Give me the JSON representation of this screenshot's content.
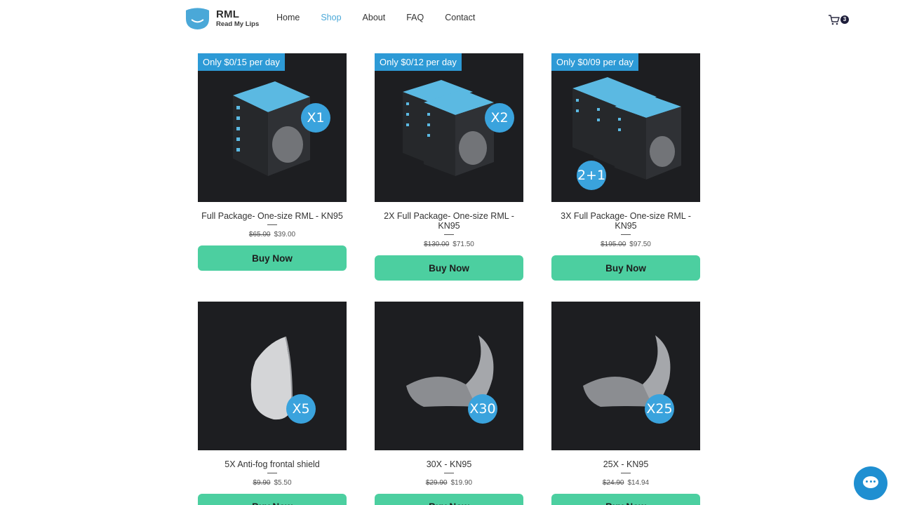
{
  "brand": {
    "title": "RML",
    "subtitle": "Read My Lips",
    "color": "#4aa8d8"
  },
  "nav": [
    {
      "label": "Home",
      "active": false
    },
    {
      "label": "Shop",
      "active": true
    },
    {
      "label": "About",
      "active": false
    },
    {
      "label": "FAQ",
      "active": false
    },
    {
      "label": "Contact",
      "active": false
    }
  ],
  "cart": {
    "icon": "cart-icon",
    "count": "3"
  },
  "products": [
    {
      "ribbon": "Only $0/15 per day",
      "badge": "X1",
      "name": "Full Package- One-size RML - KN95",
      "old_price": "$65.00",
      "price": "$39.00",
      "button": "Buy Now",
      "image": "mask-box-x1"
    },
    {
      "ribbon": "Only $0/12 per day",
      "badge": "X2",
      "name": "2X Full Package- One-size RML - KN95",
      "old_price": "$130.00",
      "price": "$71.50",
      "button": "Buy Now",
      "image": "mask-box-x2"
    },
    {
      "ribbon": "Only $0/09 per day",
      "badge": "2+1",
      "name": "3X Full Package- One-size RML - KN95",
      "old_price": "$195.00",
      "price": "$97.50",
      "button": "Buy Now",
      "image": "mask-box-x3"
    },
    {
      "ribbon": "",
      "badge": "X5",
      "name": "5X Anti-fog frontal shield",
      "old_price": "$9.90",
      "price": "$5.50",
      "button": "Buy Now",
      "image": "shield-piece"
    },
    {
      "ribbon": "",
      "badge": "X30",
      "name": "30X - KN95",
      "old_price": "$29.90",
      "price": "$19.90",
      "button": "Buy Now",
      "image": "filter-piece"
    },
    {
      "ribbon": "",
      "badge": "X25",
      "name": "25X - KN95",
      "old_price": "$24.90",
      "price": "$14.94",
      "button": "Buy Now",
      "image": "filter-piece"
    }
  ],
  "chat": {
    "icon": "chat-icon"
  },
  "colors": {
    "accent": "#2d9ad6",
    "button": "#4ccfa0",
    "tile": "#1d1e21"
  }
}
